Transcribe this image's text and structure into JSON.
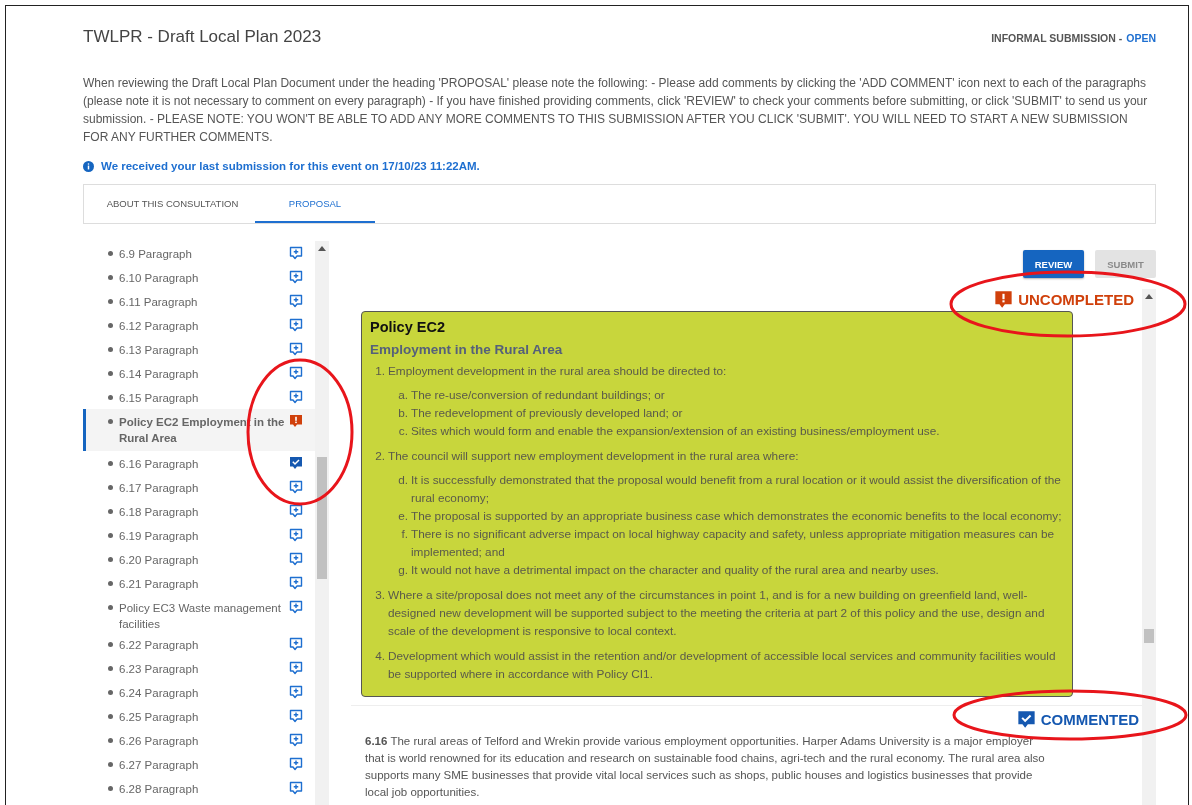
{
  "header": {
    "title": "TWLPR - Draft Local Plan 2023",
    "submission_label": "INFORMAL SUBMISSION -",
    "submission_state": "OPEN"
  },
  "instructions": "When reviewing the Draft Local Plan Document under the heading 'PROPOSAL' please note the following: - Please add comments by clicking the 'ADD COMMENT' icon next to each of the paragraphs (please note it is not necessary to comment on every paragraph) - If you have finished providing comments, click 'REVIEW' to check your comments before submitting, or click 'SUBMIT' to send us your submission. - PLEASE NOTE: YOU WON'T BE ABLE TO ADD ANY MORE COMMENTS TO THIS SUBMISSION AFTER YOU CLICK 'SUBMIT'. YOU WILL NEED TO START A NEW SUBMISSION FOR ANY FURTHER COMMENTS.",
  "info_notice": "We received your last submission for this event on 17/10/23 11:22AM.",
  "tabs": [
    {
      "label": "ABOUT THIS CONSULTATION",
      "selected": false
    },
    {
      "label": "PROPOSAL",
      "selected": true
    }
  ],
  "sidebar": {
    "items": [
      {
        "label": "6.9 Paragraph",
        "kind": "add",
        "selected": false
      },
      {
        "label": "6.10 Paragraph",
        "kind": "add",
        "selected": false
      },
      {
        "label": "6.11 Paragraph",
        "kind": "add",
        "selected": false
      },
      {
        "label": "6.12 Paragraph",
        "kind": "add",
        "selected": false
      },
      {
        "label": "6.13 Paragraph",
        "kind": "add",
        "selected": false
      },
      {
        "label": "6.14 Paragraph",
        "kind": "add",
        "selected": false
      },
      {
        "label": "6.15 Paragraph",
        "kind": "add",
        "selected": false
      },
      {
        "label": "Policy EC2 Employment in the Rural Area",
        "kind": "uncompleted",
        "selected": true
      },
      {
        "label": "6.16 Paragraph",
        "kind": "commented",
        "selected": false
      },
      {
        "label": "6.17 Paragraph",
        "kind": "add",
        "selected": false
      },
      {
        "label": "6.18 Paragraph",
        "kind": "add",
        "selected": false
      },
      {
        "label": "6.19 Paragraph",
        "kind": "add",
        "selected": false
      },
      {
        "label": "6.20 Paragraph",
        "kind": "add",
        "selected": false
      },
      {
        "label": "6.21 Paragraph",
        "kind": "add",
        "selected": false
      },
      {
        "label": "Policy EC3 Waste management facilities",
        "kind": "add",
        "selected": false
      },
      {
        "label": "6.22 Paragraph",
        "kind": "add",
        "selected": false
      },
      {
        "label": "6.23 Paragraph",
        "kind": "add",
        "selected": false
      },
      {
        "label": "6.24 Paragraph",
        "kind": "add",
        "selected": false
      },
      {
        "label": "6.25 Paragraph",
        "kind": "add",
        "selected": false
      },
      {
        "label": "6.26 Paragraph",
        "kind": "add",
        "selected": false
      },
      {
        "label": "6.27 Paragraph",
        "kind": "add",
        "selected": false
      },
      {
        "label": "6.28 Paragraph",
        "kind": "add",
        "selected": false
      }
    ]
  },
  "buttons": [
    {
      "label": "REVIEW",
      "disabled": false
    },
    {
      "label": "SUBMIT",
      "disabled": true
    }
  ],
  "sections": [
    {
      "kind": "policy",
      "status": {
        "kind": "uncompleted",
        "label": "UNCOMPLETED"
      },
      "title": "Policy EC2",
      "subtitle": "Employment in the Rural Area",
      "points": [
        {
          "marker": "1.",
          "text": "Employment development in the rural area should be directed to:",
          "subpoints": [
            {
              "marker": "a.",
              "text": "The re-use/conversion of redundant buildings; or"
            },
            {
              "marker": "b.",
              "text": "The redevelopment of previously developed land; or"
            },
            {
              "marker": "c.",
              "text": "Sites which would form and enable the expansion/extension of an existing business/employment use."
            }
          ]
        },
        {
          "marker": "2.",
          "text": "The council will support new employment development in the rural area where:",
          "subpoints": [
            {
              "marker": "d.",
              "text": "It is successfully demonstrated that the proposal would benefit from a rural location or it would assist the diversification of the rural economy;"
            },
            {
              "marker": "e.",
              "text": "The proposal is supported by an appropriate business case which demonstrates the economic benefits to the local economy;"
            },
            {
              "marker": "f.",
              "text": "There is no significant adverse impact on local highway capacity and safety, unless appropriate mitigation measures can be implemented; and"
            },
            {
              "marker": "g.",
              "text": "It would not have a detrimental impact on the character and quality of the rural area and nearby uses."
            }
          ]
        },
        {
          "marker": "3.",
          "text": "Where a site/proposal does not meet any of the circumstances in point 1, and is for a new building on greenfield land, well-designed new development will be supported subject to the meeting the criteria at part 2 of this policy and the use, design and scale of the development is responsive to local context."
        },
        {
          "marker": "4.",
          "text": "Development which would assist in the retention and/or development of accessible local services and community facilities would be supported where in accordance with Policy CI1."
        }
      ]
    },
    {
      "kind": "paragraph",
      "status": {
        "kind": "commented",
        "label": "COMMENTED"
      },
      "text": "**6.16** The rural areas of Telford and Wrekin provide various employment opportunities. Harper Adams University is a major employer that is world renowned for its education and research on sustainable food chains, agri-tech and the rural economy. The rural area also supports many SME businesses that provide vital local services such as shops, public houses and logistics businesses that provide local job opportunities."
    }
  ]
}
